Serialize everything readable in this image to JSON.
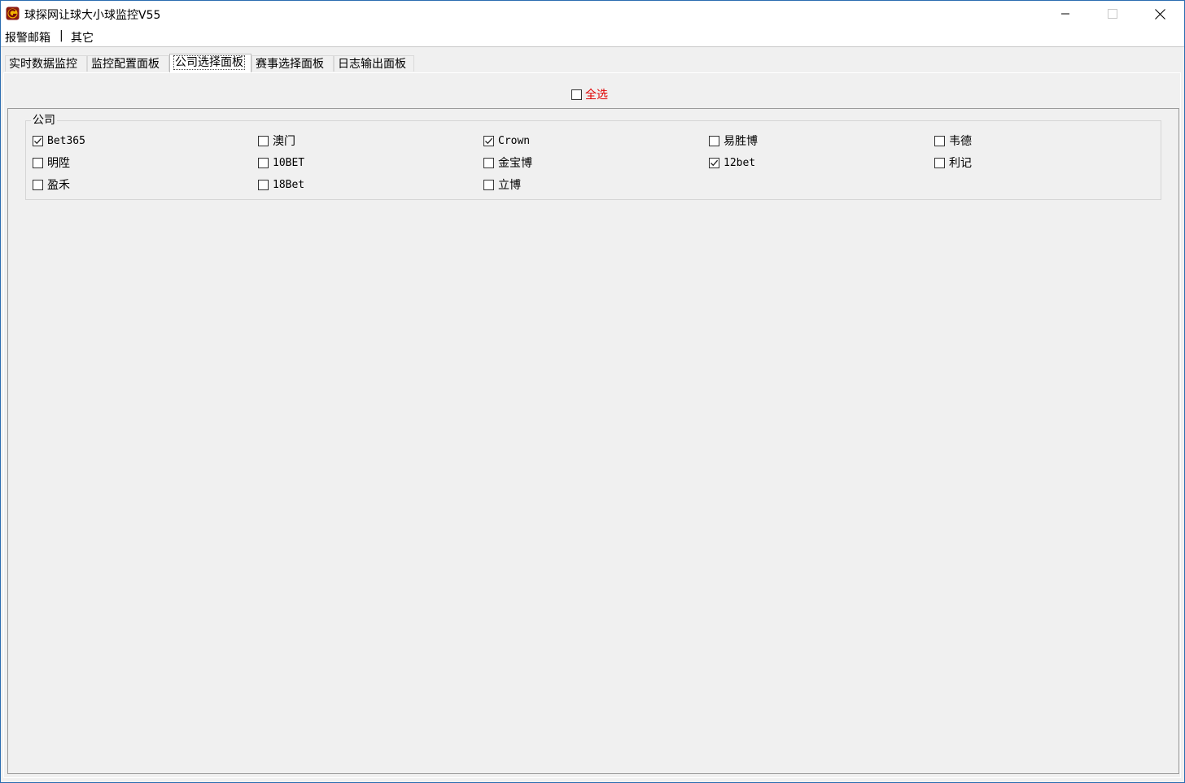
{
  "window": {
    "title": "球探网让球大小球监控V55"
  },
  "menu": {
    "items": [
      "报警邮箱",
      "其它"
    ],
    "separator": "|"
  },
  "tabs": [
    {
      "label": "实时数据监控",
      "active": false
    },
    {
      "label": "监控配置面板",
      "active": false
    },
    {
      "label": "公司选择面板",
      "active": true
    },
    {
      "label": "赛事选择面板",
      "active": false
    },
    {
      "label": "日志输出面板",
      "active": false
    }
  ],
  "select_all": {
    "label": "全选",
    "checked": false,
    "color": "#e00000"
  },
  "group": {
    "title": "公司",
    "companies": [
      {
        "label": "Bet365",
        "checked": true
      },
      {
        "label": "澳门",
        "checked": false
      },
      {
        "label": "Crown",
        "checked": true
      },
      {
        "label": "易胜博",
        "checked": false
      },
      {
        "label": "韦德",
        "checked": false
      },
      {
        "label": "明陞",
        "checked": false
      },
      {
        "label": "10BET",
        "checked": false
      },
      {
        "label": "金宝博",
        "checked": false
      },
      {
        "label": "12bet",
        "checked": true
      },
      {
        "label": "利记",
        "checked": false
      },
      {
        "label": "盈禾",
        "checked": false
      },
      {
        "label": "18Bet",
        "checked": false
      },
      {
        "label": "立博",
        "checked": false
      }
    ]
  },
  "icons": {
    "app": "app-logo-icon",
    "minimize": "minimize-icon",
    "maximize": "maximize-icon",
    "close": "close-icon"
  }
}
